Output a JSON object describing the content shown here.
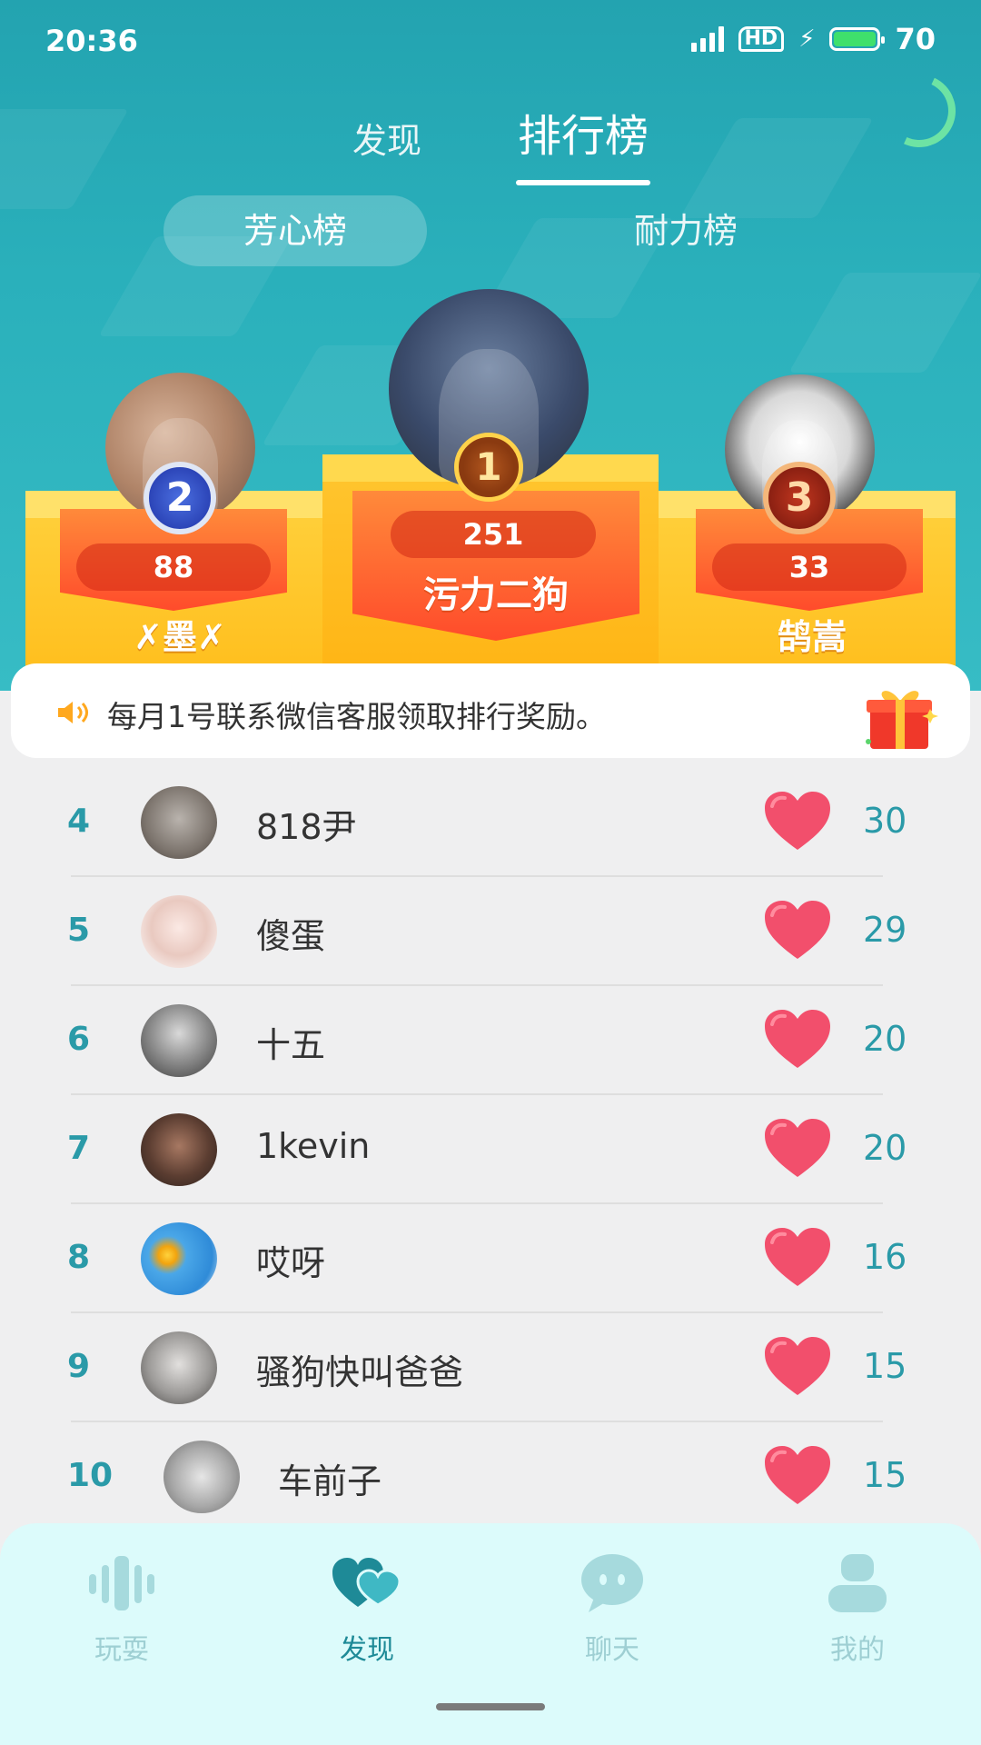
{
  "status_bar": {
    "time": "20:36",
    "network": "4G",
    "hd": "HD",
    "battery": "70",
    "battery_color": "#3fe06c"
  },
  "main_tabs": [
    {
      "label": "发现",
      "active": false
    },
    {
      "label": "排行榜",
      "active": true
    }
  ],
  "sub_tabs": [
    {
      "label": "芳心榜",
      "active": true
    },
    {
      "label": "耐力榜",
      "active": false
    }
  ],
  "podium": {
    "first": {
      "rank": "1",
      "score": "251",
      "name": "污力二狗"
    },
    "second": {
      "rank": "2",
      "score": "88",
      "name": "✗墨✗"
    },
    "third": {
      "rank": "3",
      "score": "33",
      "name": "鹄嵩"
    }
  },
  "notice": {
    "icon": "speaker-icon",
    "text": "每月1号联系微信客服领取排行奖励。",
    "gift_icon": "gift-icon"
  },
  "list": [
    {
      "rank": "4",
      "name": "818尹",
      "count": "30"
    },
    {
      "rank": "5",
      "name": "傻蛋",
      "count": "29"
    },
    {
      "rank": "6",
      "name": "十五",
      "count": "20"
    },
    {
      "rank": "7",
      "name": "1kevin",
      "count": "20"
    },
    {
      "rank": "8",
      "name": "哎呀",
      "count": "16"
    },
    {
      "rank": "9",
      "name": "骚狗快叫爸爸",
      "count": "15"
    },
    {
      "rank": "10",
      "name": "车前子",
      "count": "15"
    }
  ],
  "bottom_nav": [
    {
      "label": "玩耍",
      "icon": "sound-wave-icon",
      "active": false
    },
    {
      "label": "发现",
      "icon": "hearts-icon",
      "active": true
    },
    {
      "label": "聊天",
      "icon": "chat-bubble-icon",
      "active": false
    },
    {
      "label": "我的",
      "icon": "person-icon",
      "active": false
    }
  ],
  "colors": {
    "accent_teal": "#2a9aa8",
    "heart": "#f24f6c",
    "podium_gold": "#ffc630",
    "banner_red": "#ff4b2b"
  }
}
